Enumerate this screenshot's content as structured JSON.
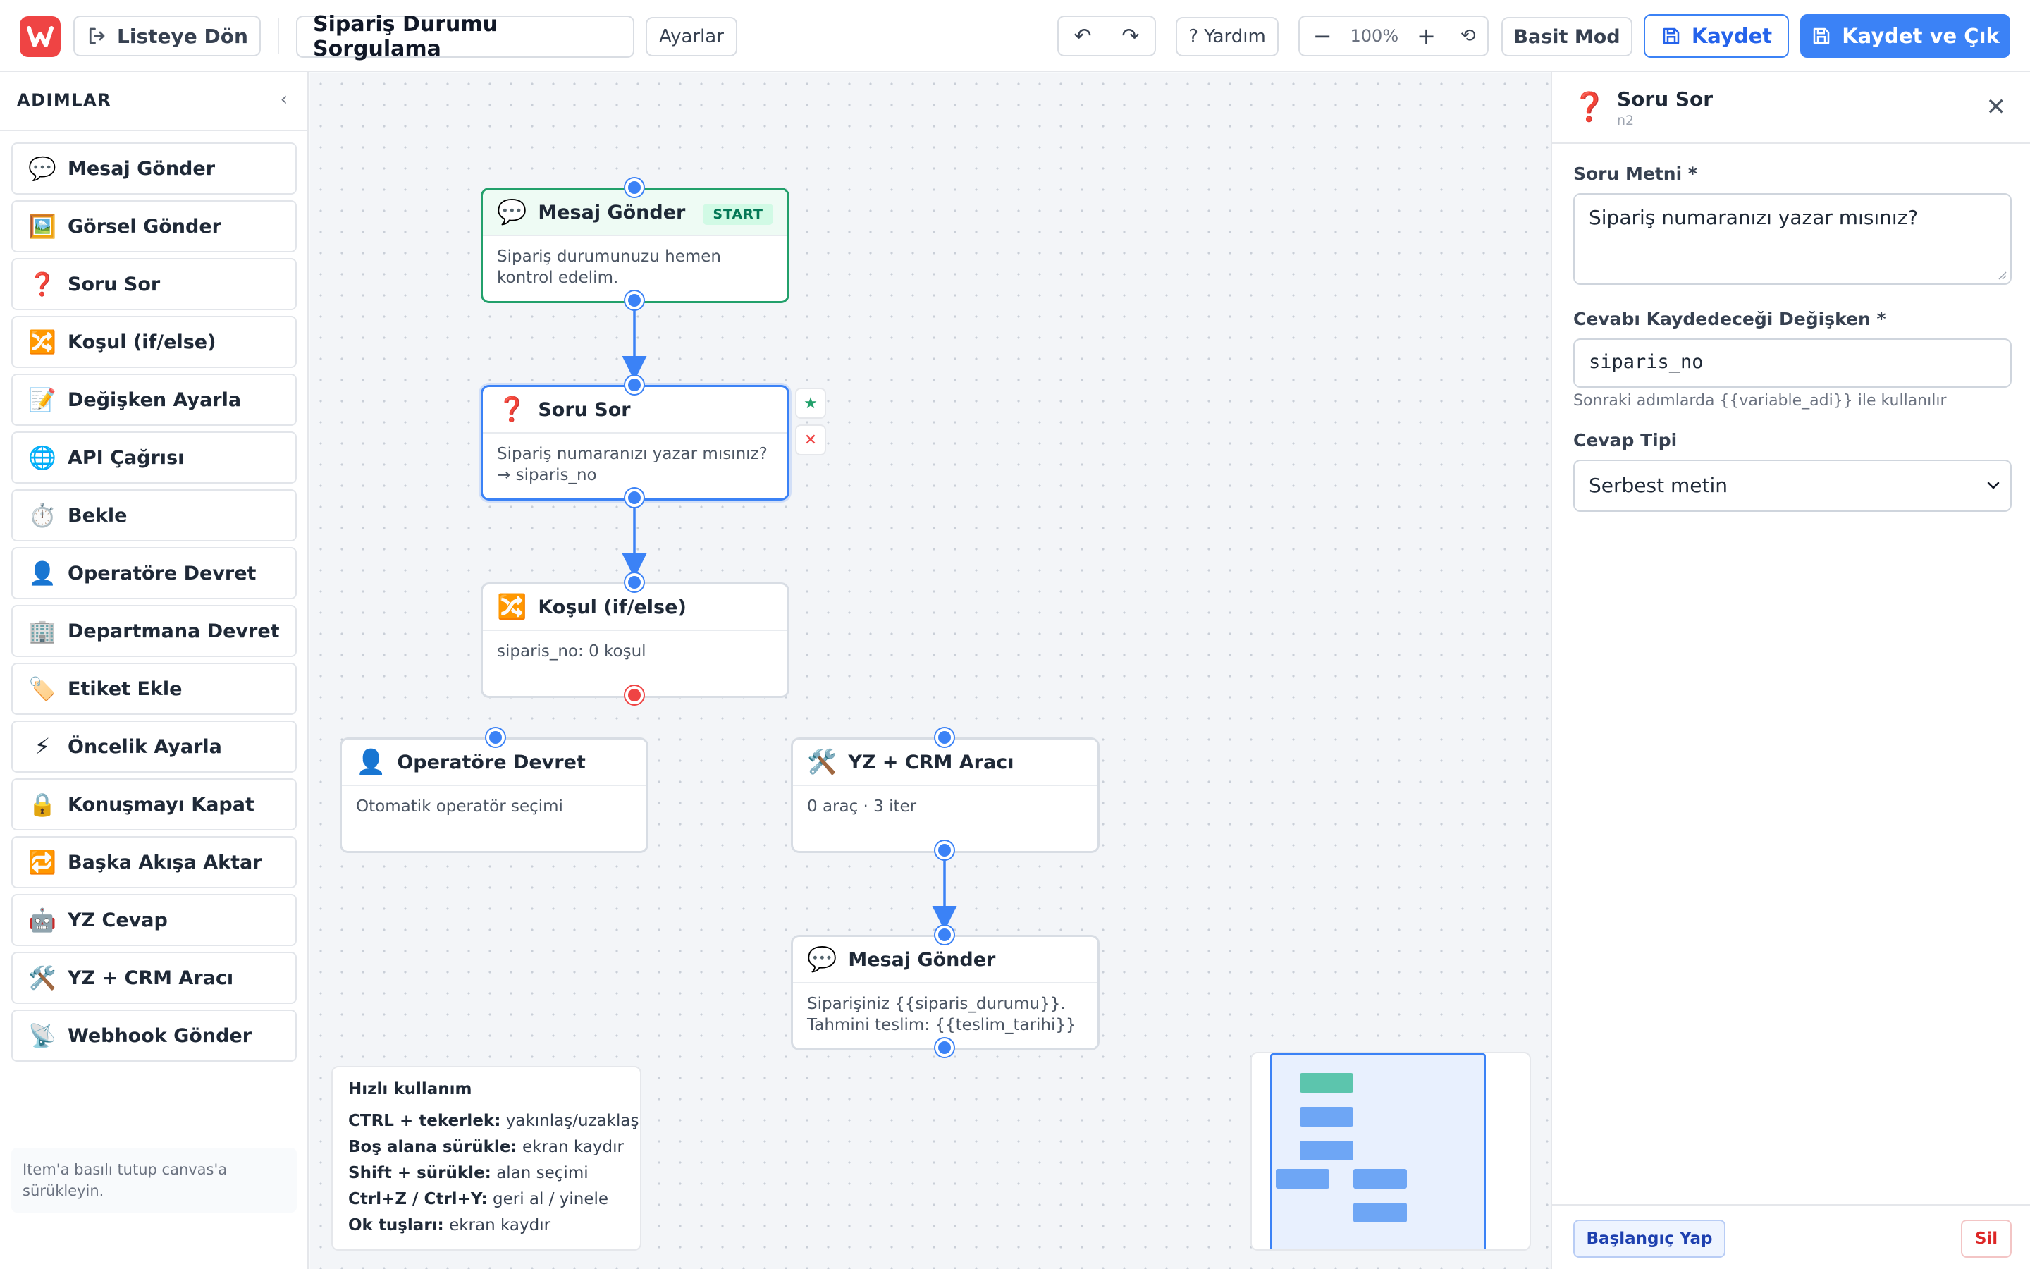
{
  "topbar": {
    "back_label": "Listeye Dön",
    "flow_title": "Sipariş Durumu Sorgulama",
    "settings_label": "Ayarlar",
    "undo_glyph": "↶",
    "redo_glyph": "↷",
    "help_label": "? Yardım",
    "zoom_out_glyph": "−",
    "zoom_level": "100%",
    "zoom_in_glyph": "+",
    "reset_glyph": "⟲",
    "simple_mode_label": "Basit Mod",
    "save_label": "Kaydet",
    "save_exit_label": "Kaydet ve Çık"
  },
  "sidebar": {
    "title": "ADIMLAR",
    "collapse_glyph": "‹",
    "items": [
      {
        "emoji": "💬",
        "label": "Mesaj Gönder"
      },
      {
        "emoji": "🖼️",
        "label": "Görsel Gönder"
      },
      {
        "emoji": "❓",
        "label": "Soru Sor"
      },
      {
        "emoji": "🔀",
        "label": "Koşul (if/else)"
      },
      {
        "emoji": "📝",
        "label": "Değişken Ayarla"
      },
      {
        "emoji": "🌐",
        "label": "API Çağrısı"
      },
      {
        "emoji": "⏱️",
        "label": "Bekle"
      },
      {
        "emoji": "👤",
        "label": "Operatöre Devret"
      },
      {
        "emoji": "🏢",
        "label": "Departmana Devret"
      },
      {
        "emoji": "🏷️",
        "label": "Etiket Ekle"
      },
      {
        "emoji": "⚡",
        "label": "Öncelik Ayarla"
      },
      {
        "emoji": "🔒",
        "label": "Konuşmayı Kapat"
      },
      {
        "emoji": "🔁",
        "label": "Başka Akışa Aktar"
      },
      {
        "emoji": "🤖",
        "label": "YZ Cevap"
      },
      {
        "emoji": "🛠️",
        "label": "YZ + CRM Aracı"
      },
      {
        "emoji": "📡",
        "label": "Webhook Gönder"
      }
    ],
    "hint": "Item'a basılı tutup canvas'a sürükleyin."
  },
  "canvas": {
    "nodes": {
      "n1": {
        "emoji": "💬",
        "title": "Mesaj Gönder",
        "badge": "START",
        "body": "Sipariş durumunuzu hemen kontrol edelim."
      },
      "n2": {
        "emoji": "❓",
        "title": "Soru Sor",
        "body_line1": "Sipariş numaranızı yazar mısınız?",
        "body_line2": "→ siparis_no"
      },
      "n3": {
        "emoji": "🔀",
        "title": "Koşul (if/else)",
        "body": "siparis_no: 0 koşul"
      },
      "n4": {
        "emoji": "👤",
        "title": "Operatöre Devret",
        "body": "Otomatik operatör seçimi"
      },
      "n5": {
        "emoji": "🛠️",
        "title": "YZ + CRM Aracı",
        "body": "0 araç · 3 iter"
      },
      "n6": {
        "emoji": "💬",
        "title": "Mesaj Gönder",
        "body_line1": "Siparişiniz {{siparis_durumu}}.",
        "body_line2": "Tahmini teslim: {{teslim_tarihi}}"
      }
    },
    "node_actions": {
      "set_start_glyph": "★",
      "delete_glyph": "✕"
    },
    "quick_help": {
      "title": "Hızlı kullanım",
      "rows": [
        {
          "key": "CTRL + tekerlek:",
          "desc": "yakınlaş/uzaklaş"
        },
        {
          "key": "Boş alana sürükle:",
          "desc": "ekran kaydır"
        },
        {
          "key": "Shift + sürükle:",
          "desc": "alan seçimi"
        },
        {
          "key": "Ctrl+Z / Ctrl+Y:",
          "desc": "geri al / yinele"
        },
        {
          "key": "Ok tuşları:",
          "desc": "ekran kaydır"
        }
      ]
    }
  },
  "panel": {
    "emoji": "❓",
    "title": "Soru Sor",
    "node_id": "n2",
    "close_glyph": "✕",
    "question_label": "Soru Metni *",
    "question_value": "Sipariş numaranızı yazar mısınız?",
    "variable_label": "Cevabı Kaydedeceği Değişken *",
    "variable_value": "siparis_no",
    "variable_help": "Sonraki adımlarda {{variable_adi}} ile kullanılır",
    "answer_type_label": "Cevap Tipi",
    "answer_type_value": "Serbest metin",
    "set_start_label": "Başlangıç Yap",
    "delete_label": "Sil"
  },
  "colors": {
    "accent": "#3b82f6",
    "start_green": "#22a06b",
    "danger": "#ef4444",
    "brand_logo": "#ef4444"
  }
}
